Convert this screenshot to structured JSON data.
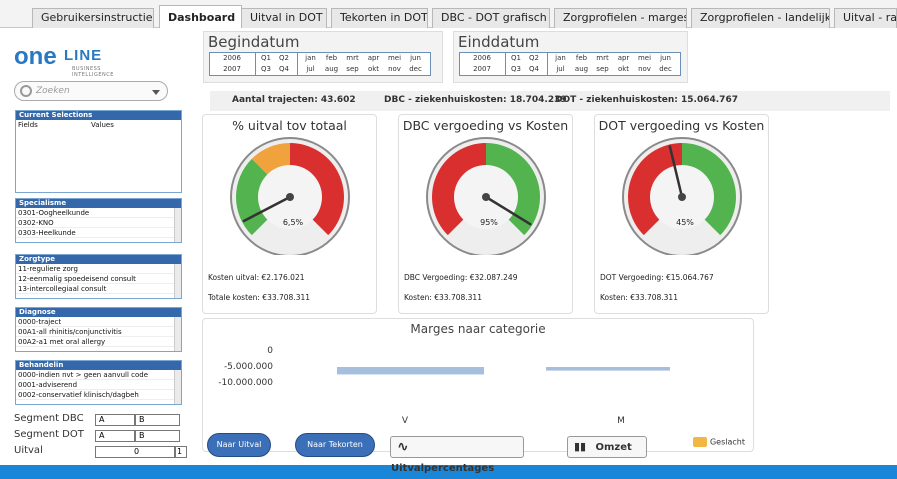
{
  "tabs": [
    "Gebruikersinstructie",
    "Dashboard",
    "Uitval in DOT",
    "Tekorten in DOT",
    "DBC - DOT grafisch",
    "Zorgprofielen - marges",
    "Zorgprofielen - landelijk",
    "Uitval - rapp"
  ],
  "logo": {
    "one": "one",
    "line": "LINE",
    "subtitle": "BUSINESS INTELLIGENCE"
  },
  "search": {
    "placeholder": "Zoeken"
  },
  "panels": {
    "current": {
      "title": "Current Selections",
      "fields": "Fields",
      "values": "Values"
    },
    "specialisme": {
      "title": "Specialisme",
      "items": [
        "0301-Oogheelkunde",
        "0302-KNO",
        "0303-Heelkunde"
      ]
    },
    "zorgtype": {
      "title": "Zorgtype",
      "items": [
        "11-reguliere zorg",
        "12-eenmalig spoedeisend consult",
        "13-intercollegiaal consult"
      ]
    },
    "diagnose": {
      "title": "Diagnose",
      "items": [
        "0000-traject",
        "00A1-all rhinitis/conjunctivitis",
        "00A2-a1 met oral allergy"
      ]
    },
    "behandeling": {
      "title": "Behandelin",
      "items": [
        "0000-indien nvt > geen aanvull code",
        "0001-adviserend",
        "0002-conservatief klinisch/dagbeh"
      ]
    }
  },
  "segments": [
    {
      "label": "Segment DBC",
      "a": "A",
      "b": "B"
    },
    {
      "label": "Segment DOT",
      "a": "A",
      "b": "B"
    },
    {
      "label": "Uitval",
      "a": "0",
      "b": "1"
    }
  ],
  "dates": {
    "begin": "Begindatum",
    "end": "Einddatum",
    "years": [
      "2006",
      "2007"
    ],
    "quarters": [
      "Q1",
      "Q2",
      "Q3",
      "Q4"
    ],
    "months": [
      "jan",
      "feb",
      "mrt",
      "apr",
      "mei",
      "jun",
      "jul",
      "aug",
      "sep",
      "okt",
      "nov",
      "dec"
    ]
  },
  "kpis": {
    "trajecten": "Aantal trajecten: 43.602",
    "dbc": "DBC - ziekenhuiskosten: 18.704.239",
    "dot": "DOT - ziekenhuiskosten: 15.064.767"
  },
  "gauges": [
    {
      "title": "% uitval tov totaal",
      "value_text": "6,5%",
      "fraction": 0.065,
      "line1": "Kosten uitval: €2.176.021",
      "line2": "Totale kosten: €33.708.311"
    },
    {
      "title": "DBC vergoeding vs Kosten",
      "value_text": "95%",
      "fraction": 0.95,
      "line1": "DBC Vergoeding: €32.087.249",
      "line2": "Kosten: €33.708.311"
    },
    {
      "title": "DOT vergoeding vs Kosten",
      "value_text": "45%",
      "fraction": 0.45,
      "line1": "DOT Vergoeding: €15.064.767",
      "line2": "Kosten: €33.708.311"
    }
  ],
  "marges": {
    "title": "Marges naar categorie",
    "ticks": [
      "0",
      "-5.000.000",
      "-10.000.000"
    ],
    "categories": [
      "V",
      "M"
    ],
    "values": [
      -6700000,
      -5500000
    ],
    "legend": "Geslacht"
  },
  "buttons": {
    "naar_uitval": "Naar Uitval",
    "naar_tekorten": "Naar Tekorten",
    "uitvalpercentages": "Uitvalpercentages",
    "omzet": "Omzet"
  },
  "colors": {
    "brand": "#2b78c2",
    "background": "#1a86d8",
    "panel_header": "#3568aa",
    "bar": "#a6bfdc",
    "gauge_red": "#d92f2f",
    "gauge_green": "#52b34f",
    "gauge_orange": "#f0a23c"
  }
}
